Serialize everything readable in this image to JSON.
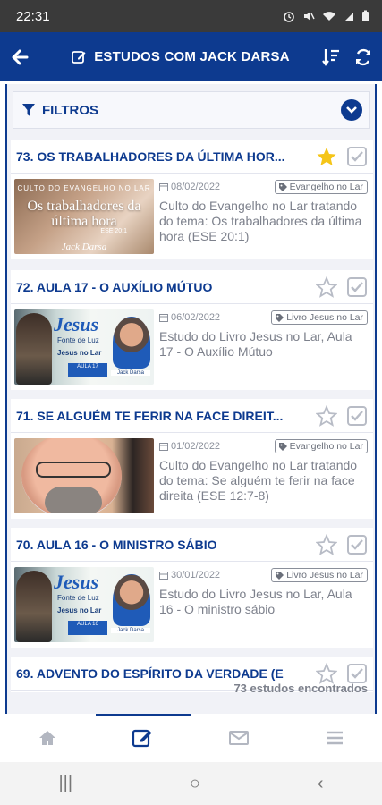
{
  "status_bar": {
    "time": "22:31",
    "icons": [
      "alarm-icon",
      "mute-icon",
      "wifi-icon",
      "signal-icon",
      "battery-icon"
    ]
  },
  "app_bar": {
    "title": "ESTUDOS COM JACK DARSA"
  },
  "filters": {
    "label": "FILTROS"
  },
  "studies": [
    {
      "title": "73. OS TRABALHADORES DA ÚLTIMA HOR...",
      "date": "08/02/2022",
      "tag": "Evangelho no Lar",
      "description": "Culto do Evangelho no Lar tratando do tema: Os trabalhadores da última hora (ESE 20:1)",
      "starred": true,
      "checked": false,
      "thumb": {
        "kind": "culto",
        "header": "CULTO DO EVANGELHO NO LAR",
        "title": "Os trabalhadores da última hora",
        "ref": "ESE 20:1",
        "signature": "Jack Darsa"
      }
    },
    {
      "title": "72. AULA 17 - O AUXÍLIO MÚTUO",
      "date": "06/02/2022",
      "tag": "Livro Jesus no Lar",
      "description": "Estudo do Livro Jesus no Lar, Aula 17 - O Auxílio Mútuo",
      "starred": false,
      "checked": false,
      "thumb": {
        "kind": "jesus",
        "title": "Jesus",
        "line1": "Fonte de Luz",
        "line2": "Jesus no Lar",
        "lesson": "AULA 17",
        "name": "Jack Darsa"
      }
    },
    {
      "title": "71. SE ALGUÉM TE FERIR NA FACE DIREIT...",
      "date": "01/02/2022",
      "tag": "Evangelho no Lar",
      "description": "Culto do Evangelho no Lar tratando do tema: Se alguém te ferir na face direita (ESE 12:7-8)",
      "starred": false,
      "checked": false,
      "thumb": {
        "kind": "face"
      }
    },
    {
      "title": "70. AULA 16 - O MINISTRO SÁBIO",
      "date": "30/01/2022",
      "tag": "Livro Jesus no Lar",
      "description": "Estudo do Livro Jesus no Lar, Aula 16 - O ministro sábio",
      "starred": false,
      "checked": false,
      "thumb": {
        "kind": "jesus",
        "title": "Jesus",
        "line1": "Fonte de Luz",
        "line2": "Jesus no Lar",
        "lesson": "AULA 16",
        "name": "Jack Darsa"
      }
    },
    {
      "title": "69. ADVENTO DO ESPÍRITO DA VERDADE (ES...",
      "starred": false,
      "checked": false
    }
  ],
  "results_count": "73 estudos encontrados",
  "bottom_nav": [
    {
      "icon": "home-icon",
      "active": false
    },
    {
      "icon": "edit-icon",
      "active": true
    },
    {
      "icon": "mail-icon",
      "active": false
    },
    {
      "icon": "menu-icon",
      "active": false
    }
  ],
  "system_nav": {
    "recent": "|||",
    "home": "○",
    "back": "‹"
  },
  "colors": {
    "primary": "#0d3a8f",
    "star": "#f5c518",
    "text_muted": "#7d818c"
  }
}
